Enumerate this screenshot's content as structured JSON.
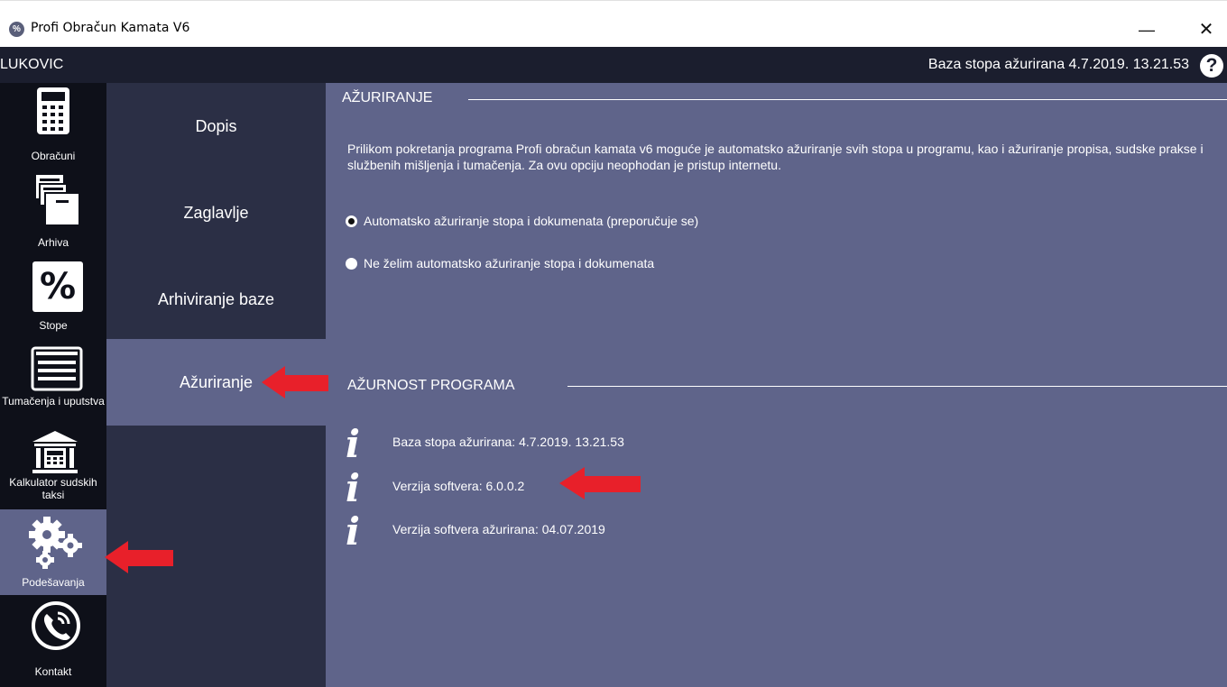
{
  "window": {
    "title": "Profi Obračun Kamata V6",
    "icon_glyph": "%",
    "controls": {
      "minimize": "—",
      "maximize": "□",
      "close": "✕"
    }
  },
  "topbar": {
    "user": "LUKOVIC",
    "db_status": "Baza stopa ažurirana 4.7.2019. 13.21.53",
    "help_glyph": "?"
  },
  "leftnav": {
    "items": [
      {
        "label": "Obračuni",
        "icon": "calculator-icon"
      },
      {
        "label": "Arhiva",
        "icon": "archive-icon"
      },
      {
        "label": "Stope",
        "icon": "percent-icon"
      },
      {
        "label": "Tumačenja i uputstva",
        "icon": "document-icon"
      },
      {
        "label": "Kalkulator sudskih taksi",
        "icon": "courthouse-icon"
      },
      {
        "label": "Podešavanja",
        "icon": "gears-icon",
        "active": true
      },
      {
        "label": "Kontakt",
        "icon": "phone-icon"
      }
    ]
  },
  "submenu": {
    "items": [
      {
        "label": "Dopis"
      },
      {
        "label": "Zaglavlje"
      },
      {
        "label": "Arhiviranje baze"
      },
      {
        "label": "Ažuriranje",
        "active": true
      }
    ]
  },
  "content": {
    "update_section": {
      "title": "AŽURIRANJE",
      "description": "Prilikom pokretanja programa Profi obračun kamata v6 moguće je automatsko ažuriranje svih stopa u programu, kao i ažuriranje propisa, sudske prakse i službenih mišljenja i tumačenja. Za ovu opciju neophodan je pristup internetu.",
      "options": [
        {
          "label": "Automatsko ažuriranje stopa i dokumenata (preporučuje se)",
          "checked": true
        },
        {
          "label": "Ne želim automatsko ažuriranje stopa i dokumenata",
          "checked": false
        }
      ]
    },
    "status_section": {
      "title": "AŽURNOST PROGRAMA",
      "info_glyph": "i",
      "rows": [
        {
          "text": "Baza stopa ažurirana: 4.7.2019. 13.21.53"
        },
        {
          "text": "Verzija softvera: 6.0.0.2"
        },
        {
          "text": "Verzija softvera ažurirana: 04.07.2019"
        }
      ]
    }
  },
  "colors": {
    "title_bar_bg": "#ffffff",
    "top_bar_bg": "#1b1e2e",
    "left_nav_bg": "#0e1019",
    "submenu_bg": "#2b2f45",
    "content_bg": "#5f648a",
    "active_bg": "#5f648a",
    "arrow_red": "#e8202a"
  }
}
